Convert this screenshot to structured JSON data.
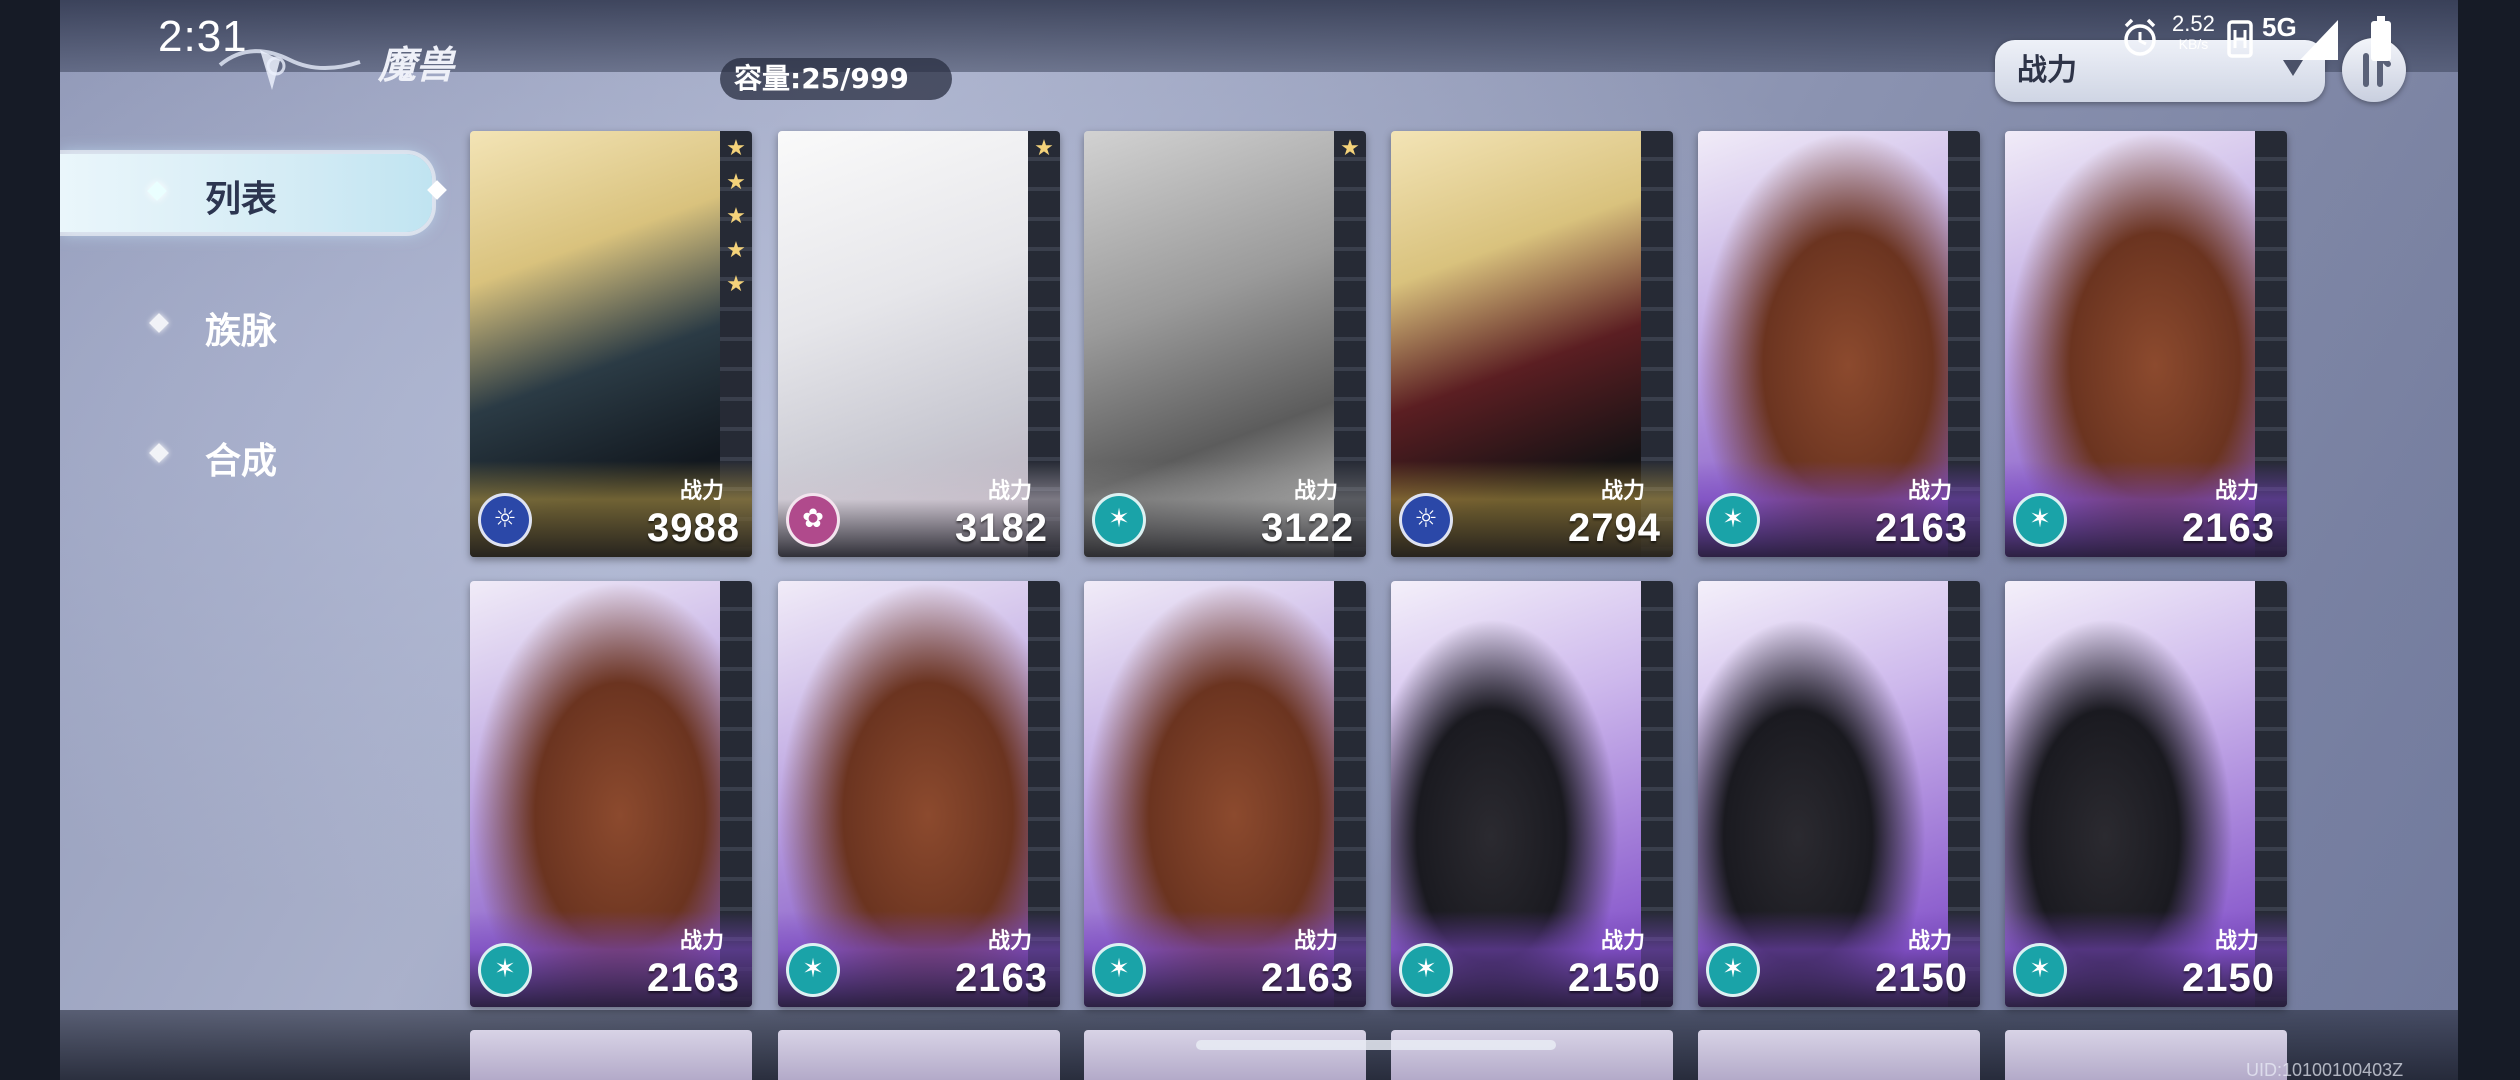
{
  "status_bar": {
    "time": "2:31",
    "net_speed": "2.52",
    "net_speed_unit": "KB/s",
    "network": "5G"
  },
  "header": {
    "title": "魔兽",
    "capacity": "容量:25/999",
    "sort_selected": "战力"
  },
  "nav": {
    "items": [
      {
        "label": "列表",
        "active": true
      },
      {
        "label": "族脉",
        "active": false
      },
      {
        "label": "合成",
        "active": false
      }
    ]
  },
  "cards": [
    {
      "power_label": "战力",
      "power": "3988",
      "stars": 5,
      "art": "dark-haired-demon",
      "rarity": "gold",
      "faction_icon": "sun-crest-icon"
    },
    {
      "power_label": "战力",
      "power": "3182",
      "stars": 1,
      "art": "white-haired-spirit",
      "rarity": "white",
      "faction_icon": "rose-crest-icon"
    },
    {
      "power_label": "战力",
      "power": "3122",
      "stars": 1,
      "art": "grey-beast-lady",
      "rarity": "grey",
      "faction_icon": "beast-crest-icon"
    },
    {
      "power_label": "战力",
      "power": "2794",
      "stars": 0,
      "art": "red-haired-demon",
      "rarity": "gold",
      "faction_icon": "sun-crest-icon"
    },
    {
      "power_label": "战力",
      "power": "2163",
      "stars": 0,
      "art": "masked-bear",
      "rarity": "purple",
      "faction_icon": "beast-crest-icon"
    },
    {
      "power_label": "战力",
      "power": "2163",
      "stars": 0,
      "art": "masked-bear",
      "rarity": "purple",
      "faction_icon": "beast-crest-icon"
    },
    {
      "power_label": "战力",
      "power": "2163",
      "stars": 0,
      "art": "masked-bear",
      "rarity": "purple",
      "faction_icon": "beast-crest-icon"
    },
    {
      "power_label": "战力",
      "power": "2163",
      "stars": 0,
      "art": "masked-bear",
      "rarity": "purple",
      "faction_icon": "beast-crest-icon"
    },
    {
      "power_label": "战力",
      "power": "2163",
      "stars": 0,
      "art": "masked-bear",
      "rarity": "purple",
      "faction_icon": "beast-crest-icon"
    },
    {
      "power_label": "战力",
      "power": "2150",
      "stars": 0,
      "art": "fire-lizard",
      "rarity": "purple",
      "faction_icon": "beast-crest-icon"
    },
    {
      "power_label": "战力",
      "power": "2150",
      "stars": 0,
      "art": "fire-lizard",
      "rarity": "purple",
      "faction_icon": "beast-crest-icon"
    },
    {
      "power_label": "战力",
      "power": "2150",
      "stars": 0,
      "art": "fire-lizard",
      "rarity": "purple",
      "faction_icon": "beast-crest-icon"
    }
  ],
  "footer": {
    "uid": "UID:10100100403Z"
  },
  "colors": {
    "accent_nav": "#d5ecf5",
    "gold_rarity": "#e7c56a",
    "purple_rarity": "#8a5fc9",
    "star": "#f4d27a",
    "badge_teal": "#1aa3a8",
    "badge_blue": "#2b48a8",
    "badge_pink": "#b04a8c"
  }
}
